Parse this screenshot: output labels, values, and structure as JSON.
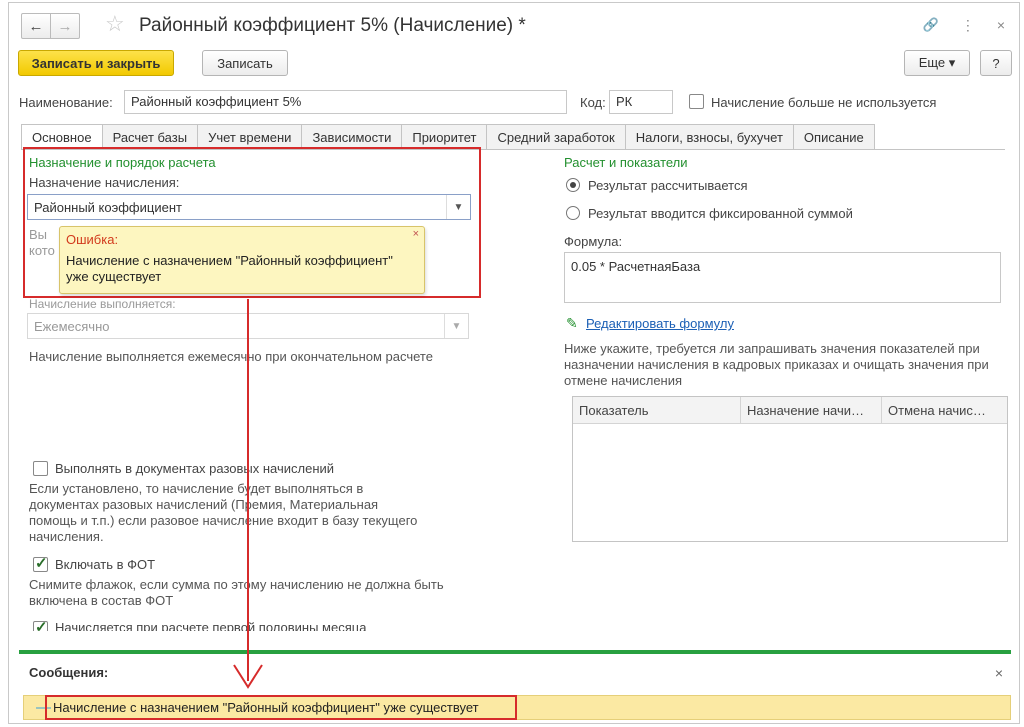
{
  "titlebar": {
    "title": "Районный коэффициент 5% (Начисление) *",
    "back_icon": "←",
    "forward_icon": "→",
    "star_icon": "☆",
    "link_icon": "🔗",
    "menu_icon": "⋮",
    "close_icon": "×"
  },
  "toolbar": {
    "save_close_label": "Записать и закрыть",
    "save_label": "Записать",
    "more_label": "Еще ▾",
    "help_label": "?"
  },
  "header": {
    "name_label": "Наименование:",
    "name_value": "Районный коэффициент 5%",
    "code_label": "Код:",
    "code_value": "РК",
    "not_used_label": "Начисление больше не используется"
  },
  "tabs": [
    "Основное",
    "Расчет базы",
    "Учет времени",
    "Зависимости",
    "Приоритет",
    "Средний заработок",
    "Налоги, взносы, бухучет",
    "Описание"
  ],
  "left": {
    "section_title": "Назначение и порядок расчета",
    "purpose_label": "Назначение начисления:",
    "purpose_value": "Районный коэффициент",
    "hidden_text_1": "Вы",
    "hidden_text_2": "кото",
    "performed_label": "Начисление выполняется:",
    "performed_value": "Ежемесячно",
    "performed_desc": "Начисление выполняется ежемесячно при окончательном расчете",
    "one_time_label": "Выполнять в документах разовых начислений",
    "one_time_desc": "Если установлено, то начисление будет выполняться в документах разовых начислений (Премия, Материальная помощь и т.п.) если разовое начисление входит в базу текущего начисления.",
    "fot_label": "Включать в ФОТ",
    "fot_desc": "Снимите флажок, если сумма по этому начислению не должна быть включена в состав ФОТ",
    "first_half_label": "Начисляется при расчете первой половины месяца"
  },
  "tooltip": {
    "title": "Ошибка:",
    "text": "Начисление с назначением \"Районный коэффициент\" уже существует",
    "close": "×"
  },
  "right": {
    "section_title": "Расчет и показатели",
    "radio_calc": "Результат рассчитывается",
    "radio_fixed": "Результат вводится фиксированной суммой",
    "formula_label": "Формула:",
    "formula_value": "0.05 * РасчетнаяБаза",
    "edit_formula": "Редактировать формулу",
    "pencil_icon": "✎",
    "indicators_desc": "Ниже укажите, требуется ли запрашивать значения показателей при назначении начисления в кадровых приказах и очищать значения при отмене начисления",
    "table_headers": [
      "Показатель",
      "Назначение начи…",
      "Отмена начис…"
    ]
  },
  "messages": {
    "title": "Сообщения:",
    "close": "×",
    "dash": "—",
    "text": "Начисление с назначением \"Районный коэффициент\" уже существует"
  },
  "colors": {
    "accent_yellow": "#f2c900",
    "green": "#23902f",
    "error_red": "#d62b2b",
    "message_bg": "#fbe9a3"
  }
}
